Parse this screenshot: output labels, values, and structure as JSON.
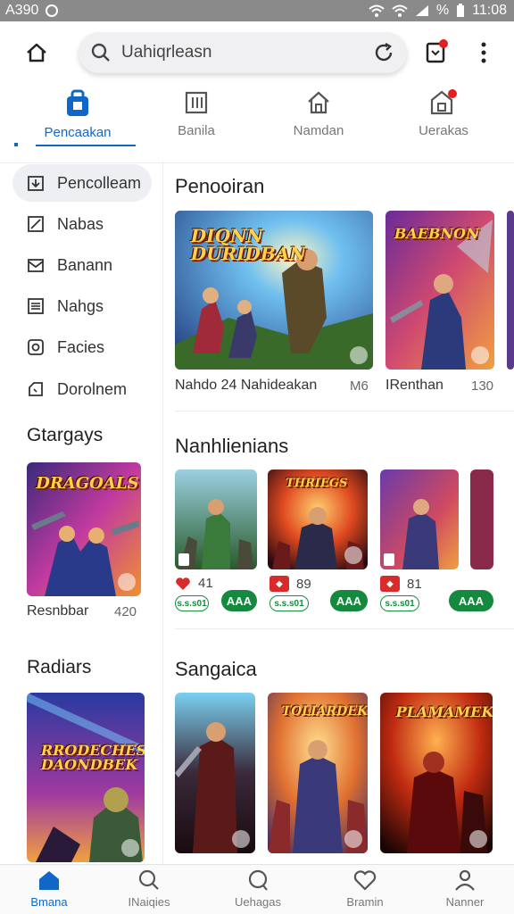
{
  "status_bar": {
    "left_text": "A390",
    "right_text": "11:08",
    "battery_label": "%"
  },
  "search": {
    "value": "Uahiqrleasn"
  },
  "tabs": [
    {
      "label": "Pencaakan",
      "icon": "bag-icon",
      "active": true
    },
    {
      "label": "Banila",
      "icon": "book-icon",
      "active": false
    },
    {
      "label": "Namdan",
      "icon": "home-icon",
      "active": false
    },
    {
      "label": "Uerakas",
      "icon": "store-icon",
      "active": false
    }
  ],
  "sidebar": {
    "items": [
      {
        "label": "Pencolleam",
        "icon": "download-icon",
        "active": true
      },
      {
        "label": "Nabas",
        "icon": "edit-icon"
      },
      {
        "label": "Banann",
        "icon": "mail-icon"
      },
      {
        "label": "Nahgs",
        "icon": "list-icon"
      },
      {
        "label": "Facies",
        "icon": "camera-icon"
      },
      {
        "label": "Dorolnem",
        "icon": "clock-icon"
      }
    ],
    "sections": [
      {
        "title": "Gtargays",
        "card_logo": "DRAGOALS",
        "caption": "Resnbbar",
        "num": "420"
      },
      {
        "title": "Radiars",
        "card_logo": "RRODECHES DAONDBEK"
      }
    ]
  },
  "main": {
    "section1": {
      "title": "Penooiran",
      "cards": [
        {
          "logo": "DIQNN DURIDBAN",
          "caption": "Nahdo 24 Nahideakan",
          "num": "M6"
        },
        {
          "logo": "BAEBNON",
          "caption": "IRenthan",
          "num": "130"
        }
      ]
    },
    "section2": {
      "title": "Nanhlienians",
      "cards": [
        {
          "logo": "",
          "rating": "41",
          "price": "s.s.s01",
          "button": "AAA"
        },
        {
          "logo": "THRIEGS",
          "rating": "89",
          "price": "s.s.s01",
          "button": "AAA"
        },
        {
          "logo": "",
          "rating": "81",
          "price": "s.s.s01",
          "button": "AAA"
        }
      ]
    },
    "section3": {
      "title": "Sangaica",
      "cards": [
        {
          "logo": ""
        },
        {
          "logo": "TOLIARDEK"
        },
        {
          "logo": "PLAMAMEK"
        }
      ]
    }
  },
  "bottom_nav": [
    {
      "label": "Bmana",
      "icon": "home-icon",
      "active": true
    },
    {
      "label": "INaiqies",
      "icon": "search-icon"
    },
    {
      "label": "Uehagas",
      "icon": "chat-icon"
    },
    {
      "label": "Bramin",
      "icon": "heart-icon"
    },
    {
      "label": "Nanner",
      "icon": "profile-icon"
    }
  ],
  "colors": {
    "accent": "#1167c8",
    "green": "#158a3e",
    "red": "#d92b2b"
  }
}
